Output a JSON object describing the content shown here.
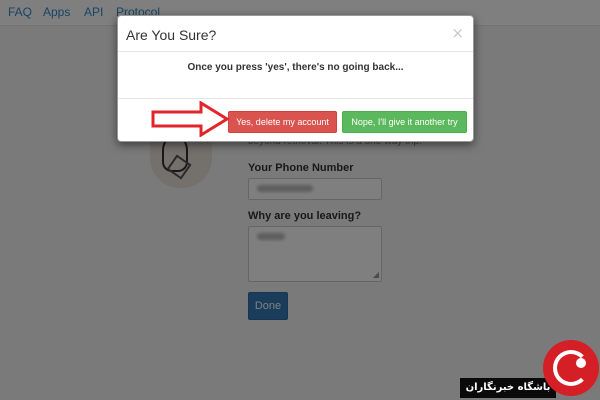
{
  "nav": {
    "links": [
      "FAQ",
      "Apps",
      "API",
      "Protocol"
    ]
  },
  "page": {
    "intro_text": "beyond retrieval. This is a one-way trip.",
    "phone_label": "Your Phone Number",
    "reason_label": "Why are you leaving?",
    "done_label": "Done"
  },
  "modal": {
    "title": "Are You Sure?",
    "close_glyph": "×",
    "message": "Once you press 'yes', there's no going back...",
    "confirm_label": "Yes, delete my account",
    "cancel_label": "Nope, I'll give it another try"
  },
  "colors": {
    "danger": "#d9534f",
    "success": "#5cb85c",
    "primary": "#337ab7",
    "annotation_arrow": "#e0252b"
  },
  "watermark": {
    "text": "باشگاه خبرنگاران"
  }
}
